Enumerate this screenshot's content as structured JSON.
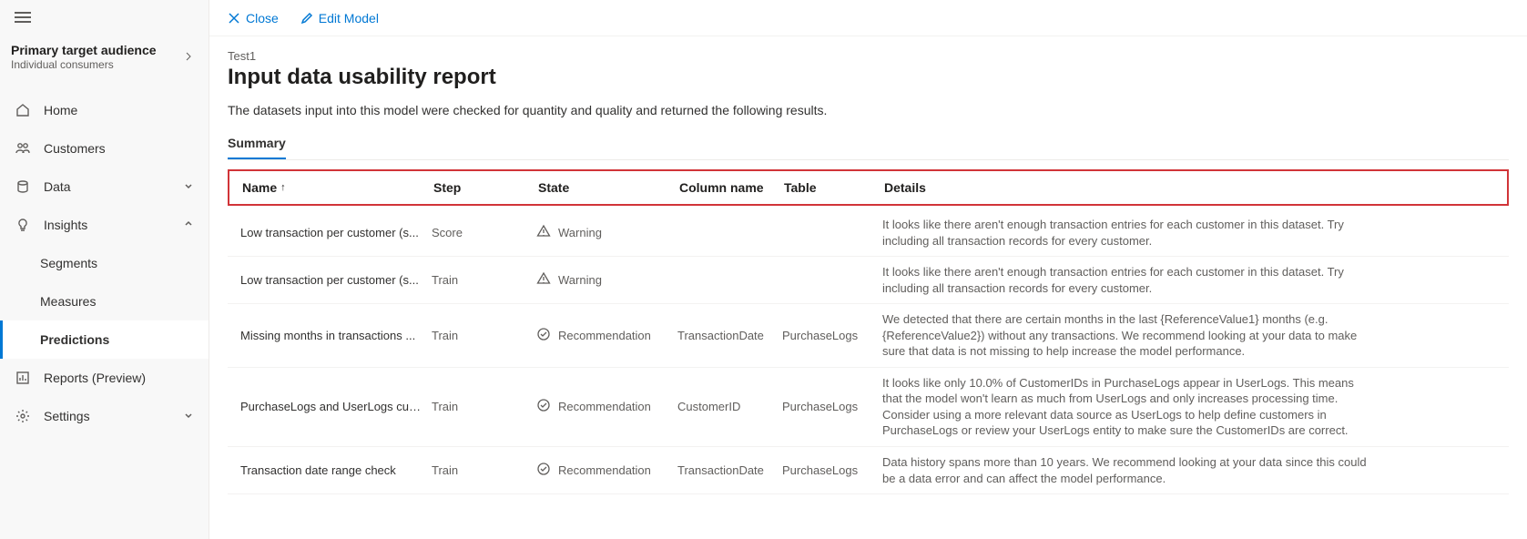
{
  "sidebar": {
    "audience": {
      "title": "Primary target audience",
      "subtitle": "Individual consumers"
    },
    "items": [
      {
        "label": "Home"
      },
      {
        "label": "Customers"
      },
      {
        "label": "Data"
      },
      {
        "label": "Insights",
        "expanded": true
      },
      {
        "label": "Segments"
      },
      {
        "label": "Measures"
      },
      {
        "label": "Predictions",
        "active": true
      },
      {
        "label": "Reports (Preview)"
      },
      {
        "label": "Settings"
      }
    ]
  },
  "toolbar": {
    "close": "Close",
    "edit": "Edit Model"
  },
  "page": {
    "breadcrumb": "Test1",
    "title": "Input data usability report",
    "description": "The datasets input into this model were checked for quantity and quality and returned the following results.",
    "tab": "Summary"
  },
  "grid": {
    "headers": {
      "name": "Name",
      "step": "Step",
      "state": "State",
      "column": "Column name",
      "table": "Table",
      "details": "Details",
      "sortIndicator": "↑"
    },
    "rows": [
      {
        "name": "Low transaction per customer (s...",
        "step": "Score",
        "state": "Warning",
        "stateIcon": "warning",
        "column": "",
        "table": "",
        "details": "It looks like there aren't enough transaction entries for each customer in this dataset. Try including all transaction records for every customer."
      },
      {
        "name": "Low transaction per customer (s...",
        "step": "Train",
        "state": "Warning",
        "stateIcon": "warning",
        "column": "",
        "table": "",
        "details": "It looks like there aren't enough transaction entries for each customer in this dataset. Try including all transaction records for every customer."
      },
      {
        "name": "Missing months in transactions ...",
        "step": "Train",
        "state": "Recommendation",
        "stateIcon": "check",
        "column": "TransactionDate",
        "table": "PurchaseLogs",
        "details": "We detected that there are certain months in the last {ReferenceValue1} months (e.g. {ReferenceValue2}) without any transactions. We recommend looking at your data to make sure that data is not missing to help increase the model performance."
      },
      {
        "name": "PurchaseLogs and UserLogs cus...",
        "step": "Train",
        "state": "Recommendation",
        "stateIcon": "check",
        "column": "CustomerID",
        "table": "PurchaseLogs",
        "details": "It looks like only 10.0% of CustomerIDs in PurchaseLogs appear in UserLogs. This means that the model won't learn as much from UserLogs and only increases processing time. Consider using a more relevant data source as UserLogs to help define customers in PurchaseLogs or review your UserLogs entity to make sure the CustomerIDs are correct."
      },
      {
        "name": "Transaction date range check",
        "step": "Train",
        "state": "Recommendation",
        "stateIcon": "check",
        "column": "TransactionDate",
        "table": "PurchaseLogs",
        "details": "Data history spans more than 10 years. We recommend looking at your data since this could be a data error and can affect the model performance."
      }
    ]
  }
}
